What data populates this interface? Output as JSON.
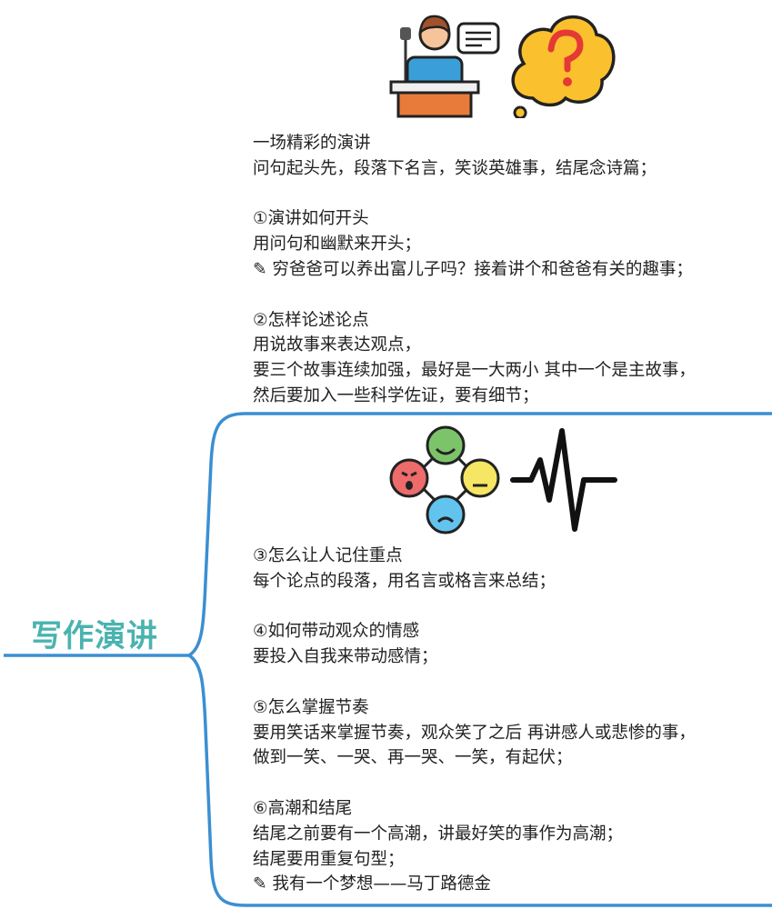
{
  "central_topic": "写作演讲",
  "colors": {
    "branch": "#3b8fd1",
    "central_text": "#4ab3b0"
  },
  "upper_branch": {
    "icons": [
      "speaker-at-podium-icon",
      "question-cloud-icon"
    ],
    "sections": [
      {
        "lines": [
          "一场精彩的演讲",
          "问句起头先，段落下名言，笑谈英雄事，结尾念诗篇；"
        ]
      },
      {
        "lines": [
          "①演讲如何开头",
          "用问句和幽默来开头；",
          "✎ 穷爸爸可以养出富儿子吗？接着讲个和爸爸有关的趣事；"
        ]
      },
      {
        "lines": [
          "②怎样论述论点",
          "用说故事来表达观点，",
          "要三个故事连续加强，最好是一大两小 其中一个是主故事，",
          "然后要加入一些科学佐证，要有细节；"
        ]
      }
    ]
  },
  "lower_branch": {
    "icons": [
      "emotion-faces-icon",
      "heartbeat-icon"
    ],
    "sections": [
      {
        "lines": [
          "③怎么让人记住重点",
          "每个论点的段落，用名言或格言来总结；"
        ]
      },
      {
        "lines": [
          "④如何带动观众的情感",
          "要投入自我来带动感情；"
        ]
      },
      {
        "lines": [
          "⑤怎么掌握节奏",
          "要用笑话来掌握节奏，观众笑了之后 再讲感人或悲惨的事，",
          "做到一笑、一哭、再一哭、一笑，有起伏；"
        ]
      },
      {
        "lines": [
          "⑥高潮和结尾",
          "结尾之前要有一个高潮，讲最好笑的事作为高潮；",
          "结尾要用重复句型；",
          "✎ 我有一个梦想——马丁路德金"
        ]
      }
    ]
  }
}
